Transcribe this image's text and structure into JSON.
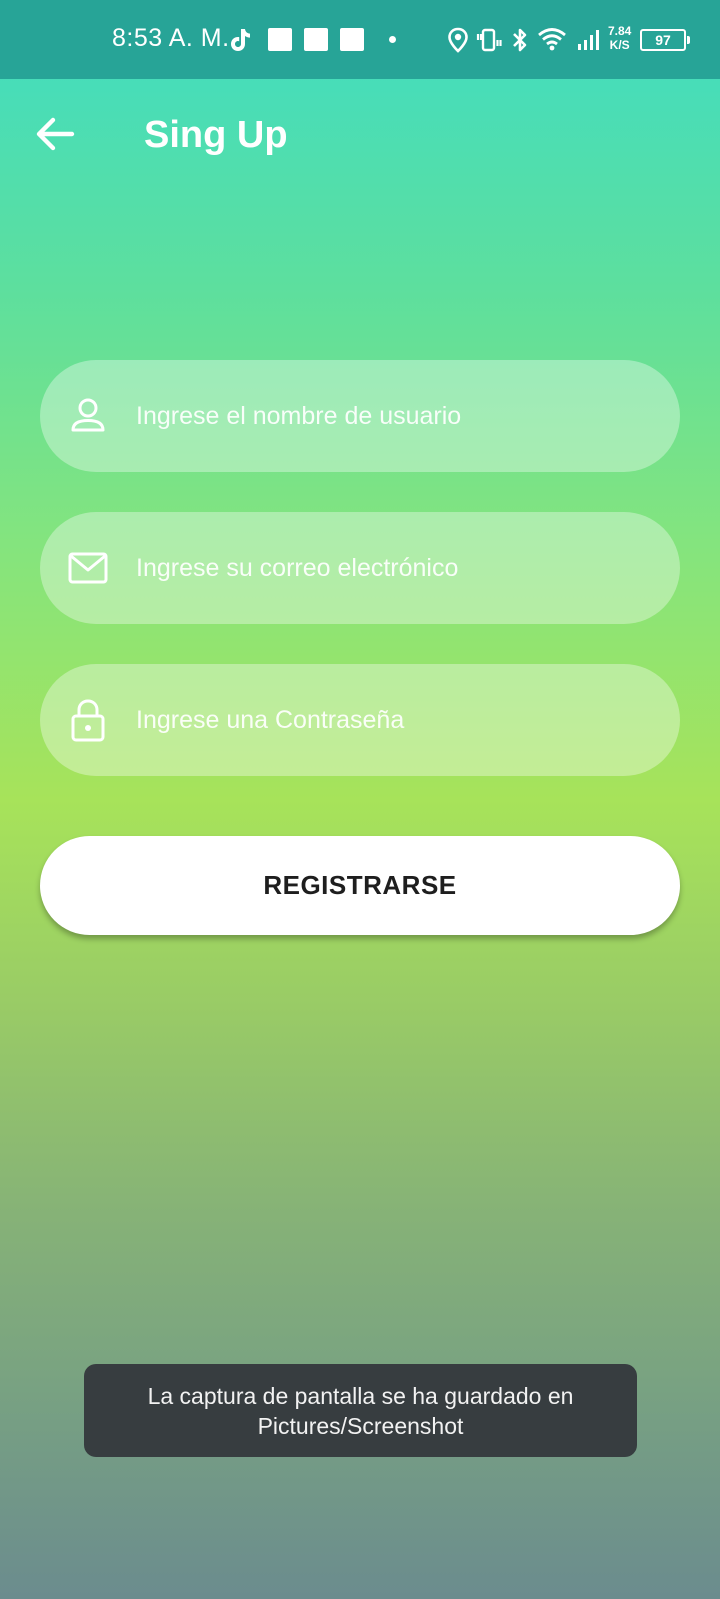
{
  "status_bar": {
    "time": "8:53 A. M.",
    "net_speed_value": "7.84",
    "net_speed_unit": "K/S",
    "battery": "97",
    "icons": [
      "tiktok-icon",
      "notification-square-icon",
      "notification-square-icon",
      "notification-square-icon",
      "more-notifications-dot",
      "location-icon",
      "vibrate-icon",
      "bluetooth-icon",
      "wifi-icon",
      "signal-icon",
      "battery-icon"
    ]
  },
  "header": {
    "back_icon": "arrow-left-icon",
    "title": "Sing Up"
  },
  "form": {
    "username": {
      "icon": "person-icon",
      "placeholder": "Ingrese el nombre de usuario"
    },
    "email": {
      "icon": "mail-icon",
      "placeholder": "Ingrese su correo electrónico"
    },
    "password": {
      "icon": "lock-icon",
      "placeholder": "Ingrese una Contraseña"
    },
    "submit_label": "REGISTRARSE"
  },
  "toast": {
    "line1": "La captura de pantalla se ha guardado en",
    "line2": "Pictures/Screenshot"
  },
  "colors": {
    "status_bar": "#27a497",
    "gradient_top": "#3fdcc3",
    "gradient_mid": "#a7e35a",
    "gradient_bottom": "#6b8c8e",
    "button_bg": "#ffffff",
    "button_text": "#1e1e1e",
    "toast_bg": "#373d40"
  }
}
